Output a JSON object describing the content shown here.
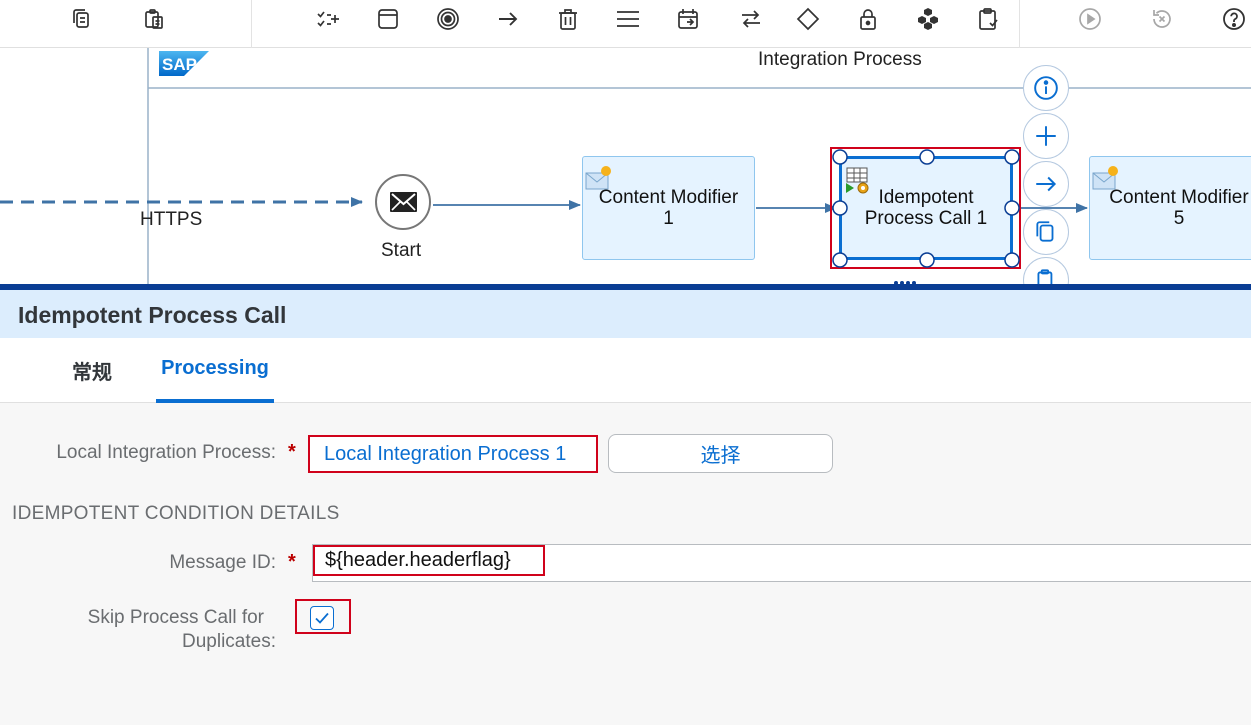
{
  "toolbar": {
    "icons": [
      "copy-icon",
      "paste-icon",
      "checklist-icon",
      "maximize-icon",
      "target-icon",
      "arrow-right-icon",
      "delete-icon",
      "menu-icon",
      "calendar-icon",
      "exchange-icon",
      "diamond-icon",
      "lock-icon",
      "cube-group-icon",
      "clipboard-check-icon",
      "play-icon",
      "undo-icon",
      "help-icon"
    ]
  },
  "canvas": {
    "logo_text": "SAP",
    "pool_title": "Integration Process",
    "connection_label": "HTTPS",
    "start_label": "Start",
    "nodes": [
      {
        "label": "Content Modifier\n1"
      },
      {
        "label": "Idempotent\nProcess Call 1"
      },
      {
        "label": "Content Modifier\n5"
      }
    ],
    "context_icons": [
      "info-icon",
      "add-icon",
      "connect-icon",
      "copy-icon",
      "paste-icon"
    ]
  },
  "panel": {
    "title": "Idempotent Process Call",
    "tabs": [
      {
        "label": "常规",
        "active": false
      },
      {
        "label": "Processing",
        "active": true
      }
    ]
  },
  "form": {
    "local_process_label": "Local Integration Process:",
    "local_process_value": "Local Integration Process 1",
    "select_button": "选择",
    "section_title": "IDEMPOTENT CONDITION DETAILS",
    "message_id_label": "Message ID:",
    "message_id_value": "${header.headerflag}",
    "skip_label_line1": "Skip Process Call for",
    "skip_label_line2": "Duplicates:",
    "skip_checked": true
  },
  "colors": {
    "accent": "#0a6ed1",
    "highlight": "#d0021b",
    "panel_header": "#dcedfd"
  }
}
